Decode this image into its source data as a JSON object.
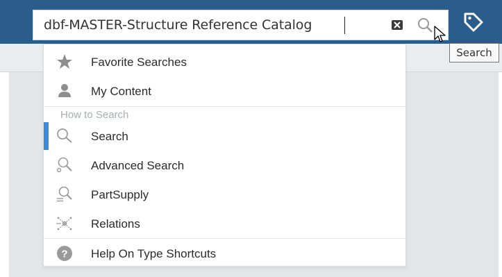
{
  "search": {
    "value": "dbf-MASTER-Structure Reference Catalog",
    "tooltip": "Search"
  },
  "dropdown": {
    "items_top": [
      {
        "label": "Favorite Searches",
        "icon": "star-icon"
      },
      {
        "label": "My Content",
        "icon": "person-icon"
      }
    ],
    "section_header": "How to Search",
    "items_search": [
      {
        "label": "Search",
        "icon": "magnifier-icon",
        "active": true
      },
      {
        "label": "Advanced Search",
        "icon": "advanced-search-icon"
      },
      {
        "label": "PartSupply",
        "icon": "partsupply-icon"
      },
      {
        "label": "Relations",
        "icon": "relations-icon"
      }
    ],
    "help": {
      "label": "Help On Type Shortcuts",
      "icon": "help-icon"
    }
  },
  "colors": {
    "topbar": "#2a5c8c",
    "active_indicator": "#3b8ad9"
  }
}
